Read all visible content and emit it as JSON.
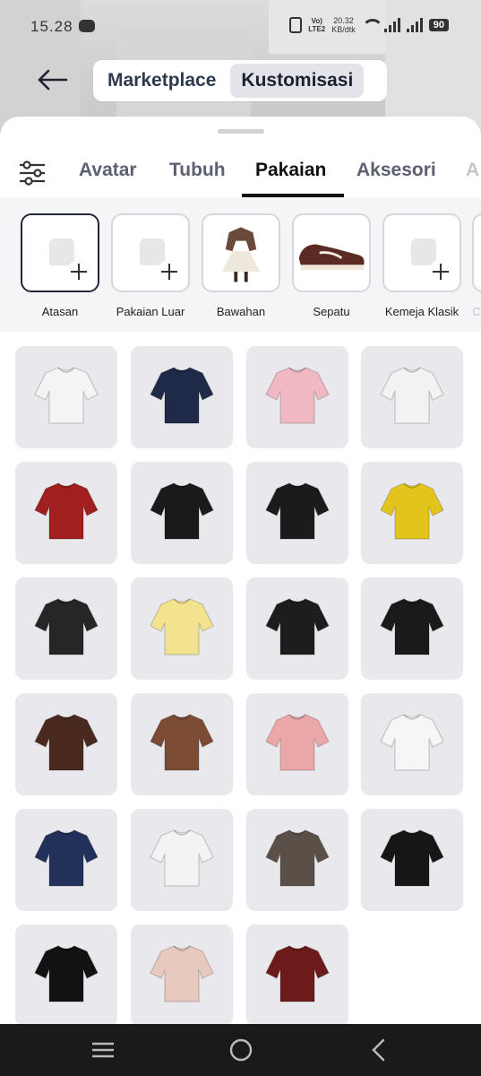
{
  "status": {
    "time": "15.28",
    "volte_line1": "Vo)",
    "volte_line2": "LTE2",
    "speed_line1": "20.32",
    "speed_line2": "KB/dtk",
    "battery": "90"
  },
  "header": {
    "segments": [
      {
        "label": "Marketplace",
        "active": false
      },
      {
        "label": "Kustomisasi",
        "active": true
      }
    ]
  },
  "tabs": [
    {
      "label": "Avatar"
    },
    {
      "label": "Tubuh"
    },
    {
      "label": "Pakaian",
      "active": true
    },
    {
      "label": "Aksesori"
    },
    {
      "label": "A"
    }
  ],
  "categories": [
    {
      "label": "Atasan",
      "icon": "shirt-add-icon",
      "selected": true
    },
    {
      "label": "Pakaian Luar",
      "icon": "jacket-add-icon"
    },
    {
      "label": "Bawahan",
      "icon": "outfit-thumbnail"
    },
    {
      "label": "Sepatu",
      "icon": "sneaker-thumbnail"
    },
    {
      "label": "Kemeja Klasik",
      "icon": "classic-shirt-add-icon"
    },
    {
      "label": "C"
    }
  ],
  "items": [
    {
      "name": "white-long-sleeve-shirt",
      "color": "#f4f4f4"
    },
    {
      "name": "navy-jersey-89",
      "color": "#1f2a48"
    },
    {
      "name": "pink-star-sweater",
      "color": "#f0b9c2"
    },
    {
      "name": "white-polo-with-badge",
      "color": "#f2f2f2"
    },
    {
      "name": "red-crop-top",
      "color": "#a11f1f"
    },
    {
      "name": "black-accessory-set",
      "color": "#1a1a1a"
    },
    {
      "name": "black-cami-top",
      "color": "#1b1b1b"
    },
    {
      "name": "brasil-tank-top",
      "color": "#e3c41d"
    },
    {
      "name": "black-graphic-tee",
      "color": "#262626"
    },
    {
      "name": "yellow-crop-tee",
      "color": "#f3e38f"
    },
    {
      "name": "black-pink-lace-top",
      "color": "#1d1d1d"
    },
    {
      "name": "black-mini-set",
      "color": "#1a1a1a"
    },
    {
      "name": "brown-crop-tank",
      "color": "#4a2a1f"
    },
    {
      "name": "brown-cardigan",
      "color": "#7b4b34"
    },
    {
      "name": "pink-bow-blouse",
      "color": "#e9a7a8"
    },
    {
      "name": "white-wrap-top",
      "color": "#f6f6f6"
    },
    {
      "name": "navy-tank-top",
      "color": "#22315a"
    },
    {
      "name": "white-sweatshirt",
      "color": "#f3f3f3"
    },
    {
      "name": "gray-99-jersey",
      "color": "#5a5048"
    },
    {
      "name": "black-leather-jacket",
      "color": "#161616"
    },
    {
      "name": "black-chain-tee",
      "color": "#121212"
    },
    {
      "name": "bow-puff-jacket",
      "color": "#e7c9bd"
    },
    {
      "name": "full-outfit-burgundy",
      "color": "#6c1a1a"
    }
  ]
}
